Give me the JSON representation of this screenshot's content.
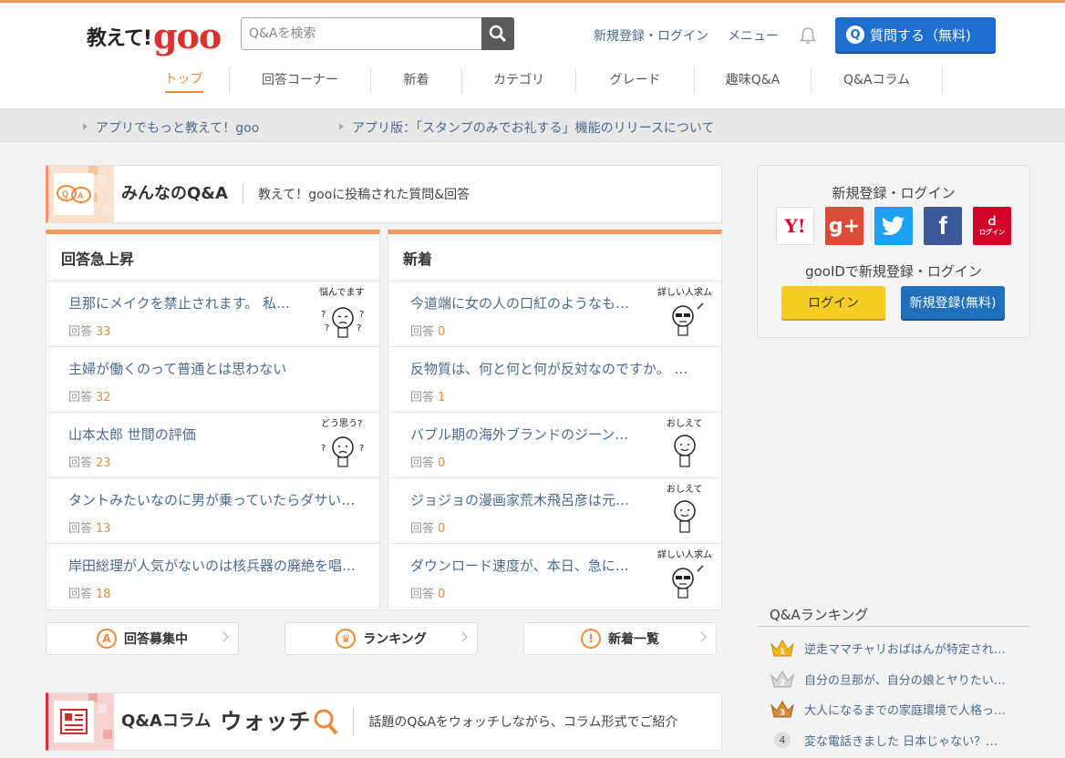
{
  "header": {
    "logo_jp": "教えて!",
    "logo_goo": "goo",
    "search_placeholder": "Q&Aを検索",
    "login_link": "新規登録・ログイン",
    "menu_link": "メニュー",
    "ask_button": "質問する（無料)",
    "ask_q": "Q"
  },
  "nav": {
    "tabs": [
      "トップ",
      "回答コーナー",
      "新着",
      "カテゴリ",
      "グレード",
      "趣味Q&A",
      "Q&Aコラム"
    ]
  },
  "infobar": {
    "item1": "アプリでもっと教えて！goo",
    "item2": "アプリ版：「スタンプのみでお礼する」機能のリリースについて"
  },
  "qa_section": {
    "title": "みんなのQ&A",
    "subtitle": "教えて！gooに投稿された質問&回答"
  },
  "left_list": {
    "heading": "回答急上昇",
    "items": [
      {
        "title": "旦那にメイクを禁止されます。 私…",
        "label": "回答",
        "count": "33",
        "char": "悩んでます"
      },
      {
        "title": "主婦が働くのって普通とは思わない",
        "label": "回答",
        "count": "32"
      },
      {
        "title": "山本太郎 世間の評価",
        "label": "回答",
        "count": "23",
        "char": "どう思う?"
      },
      {
        "title": "タントみたいなのに男が乗っていたらダサい…",
        "label": "回答",
        "count": "13"
      },
      {
        "title": "岸田総理が人気がないのは核兵器の廃絶を唱…",
        "label": "回答",
        "count": "18"
      }
    ]
  },
  "right_list": {
    "heading": "新着",
    "items": [
      {
        "title": "今道端に女の人の口紅のようなも…",
        "label": "回答",
        "count": "0",
        "char": "詳しい人求ム"
      },
      {
        "title": "反物質は、何と何と何が反対なのですか。 …",
        "label": "回答",
        "count": "1"
      },
      {
        "title": "バブル期の海外ブランドのジーン…",
        "label": "回答",
        "count": "0",
        "char": "おしえて"
      },
      {
        "title": "ジョジョの漫画家荒木飛呂彦は元…",
        "label": "回答",
        "count": "0",
        "char": "おしえて"
      },
      {
        "title": "ダウンロード速度が、本日、急に…",
        "label": "回答",
        "count": "0",
        "char": "詳しい人求ム"
      }
    ]
  },
  "bottom_buttons": {
    "answer": "回答募集中",
    "ranking": "ランキング",
    "newlist": "新着一覧"
  },
  "column_section": {
    "title": "Q&Aコラム",
    "title_watch": "ウォッチ",
    "subtitle": "話題のQ&Aをウォッチしながら、コラム形式でご紹介"
  },
  "sidebar": {
    "login_title": "新規登録・ログイン",
    "sns": [
      "Y!",
      "g+",
      "twitter",
      "f",
      "dログイン"
    ],
    "goo_title": "gooIDで新規登録・ログイン",
    "login_btn": "ログイン",
    "register_btn": "新規登録(無料)",
    "ranking_heading": "Q&Aランキング",
    "ranking": [
      {
        "rank": "1",
        "title": "逆走ママチャリおばはんが特定され…"
      },
      {
        "rank": "2",
        "title": "自分の旦那が、自分の娘とヤりたい…"
      },
      {
        "rank": "3",
        "title": "大人になるまでの家庭環境で人格っ…"
      },
      {
        "rank": "4",
        "title": "変な電話きました 日本じゃない？…"
      }
    ]
  },
  "colors": {
    "accent": "#f08a3a",
    "link": "#4a6a8f",
    "brand_red": "#d9322e",
    "ask_blue": "#1f6fd0"
  }
}
